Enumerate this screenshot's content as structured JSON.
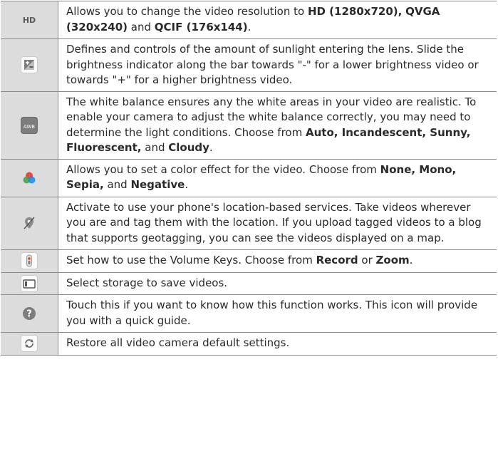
{
  "rows": [
    {
      "icon": "hd-icon",
      "segments": [
        {
          "t": "Allows you to change the video resolution to ",
          "b": false
        },
        {
          "t": "HD (1280x720),",
          "b": true
        },
        {
          "t": " ",
          "b": false
        },
        {
          "t": "QVGA (320x240)",
          "b": true
        },
        {
          "t": " and ",
          "b": false
        },
        {
          "t": "QCIF (176x144)",
          "b": true
        },
        {
          "t": ".",
          "b": false
        }
      ]
    },
    {
      "icon": "brightness-icon",
      "segments": [
        {
          "t": "Defines and controls of the amount of sunlight entering the lens. Slide the brightness indicator along the bar towards \"-\" for a lower brightness video or towards \"+\" for a higher brightness video.",
          "b": false
        }
      ]
    },
    {
      "icon": "awb-icon",
      "segments": [
        {
          "t": "The white balance ensures any the white areas in your video are realistic. To enable your camera to adjust the white balance correctly, you may need to determine the light conditions. Choose from ",
          "b": false
        },
        {
          "t": "Auto, Incandescent, Sunny, Fluorescent,",
          "b": true
        },
        {
          "t": " and ",
          "b": false
        },
        {
          "t": "Cloudy",
          "b": true
        },
        {
          "t": ".",
          "b": false
        }
      ]
    },
    {
      "icon": "color-effect-icon",
      "segments": [
        {
          "t": "Allows you to set a color effect for the video. Choose from ",
          "b": false
        },
        {
          "t": "None, Mono, Sepia,",
          "b": true
        },
        {
          "t": " and ",
          "b": false
        },
        {
          "t": "Negative",
          "b": true
        },
        {
          "t": ".",
          "b": false
        }
      ]
    },
    {
      "icon": "geotag-icon",
      "segments": [
        {
          "t": "Activate to use your phone's location-based services. Take videos wherever you are and tag them with the location. If you upload tagged videos to a blog that supports geotagging, you can see the videos displayed on a map.",
          "b": false
        }
      ]
    },
    {
      "icon": "volume-key-icon",
      "segments": [
        {
          "t": "Set how to use the Volume Keys. Choose from ",
          "b": false
        },
        {
          "t": "Record",
          "b": true
        },
        {
          "t": " or ",
          "b": false
        },
        {
          "t": "Zoom",
          "b": true
        },
        {
          "t": ".",
          "b": false
        }
      ]
    },
    {
      "icon": "storage-icon",
      "segments": [
        {
          "t": "Select storage to save videos.",
          "b": false
        }
      ]
    },
    {
      "icon": "help-icon",
      "segments": [
        {
          "t": "Touch this if you want to know how this function works. This icon will provide you with a quick guide.",
          "b": false
        }
      ]
    },
    {
      "icon": "reset-icon",
      "segments": [
        {
          "t": "Restore all video camera default settings.",
          "b": false
        }
      ]
    }
  ],
  "icon_labels": {
    "hd": "HD",
    "awb": "AWB"
  }
}
